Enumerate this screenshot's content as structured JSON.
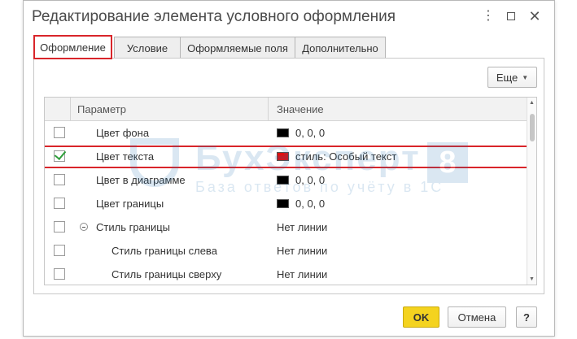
{
  "window": {
    "title": "Редактирование элемента условного оформления",
    "icons": {
      "more": "more-vertical-icon",
      "maximize": "maximize-icon",
      "close": "close-icon"
    }
  },
  "tabs": [
    {
      "label": "Оформление",
      "active": true
    },
    {
      "label": "Условие",
      "active": false
    },
    {
      "label": "Оформляемые поля",
      "active": false
    },
    {
      "label": "Дополнительно",
      "active": false
    }
  ],
  "toolbar": {
    "more_label": "Еще"
  },
  "grid": {
    "columns": {
      "param": "Параметр",
      "value": "Значение"
    },
    "rows": [
      {
        "checked": false,
        "param": "Цвет фона",
        "value": "0, 0, 0",
        "swatch": "#000000",
        "level": 1
      },
      {
        "checked": true,
        "param": "Цвет текста",
        "value": "стиль: Особый текст",
        "swatch": "#e01010",
        "level": 1
      },
      {
        "checked": false,
        "param": "Цвет в диаграмме",
        "value": "0, 0, 0",
        "swatch": "#000000",
        "level": 1
      },
      {
        "checked": false,
        "param": "Цвет границы",
        "value": "0, 0, 0",
        "swatch": "#000000",
        "level": 1
      },
      {
        "checked": false,
        "param": "Стиль границы",
        "value": "Нет линии",
        "swatch": null,
        "level": 0,
        "expanded": true
      },
      {
        "checked": false,
        "param": "Стиль границы слева",
        "value": "Нет линии",
        "swatch": null,
        "level": 2
      },
      {
        "checked": false,
        "param": "Стиль границы сверху",
        "value": "Нет линии",
        "swatch": null,
        "level": 2
      }
    ]
  },
  "watermark": {
    "brand": "БухЭксперт",
    "tagline": "База ответов по учёту в 1С",
    "badge": "8"
  },
  "buttons": {
    "ok": "OK",
    "cancel": "Отмена",
    "help": "?"
  },
  "colors": {
    "accent": "#f4d31f",
    "highlight": "#d9252a",
    "check": "#2e9e3a"
  }
}
